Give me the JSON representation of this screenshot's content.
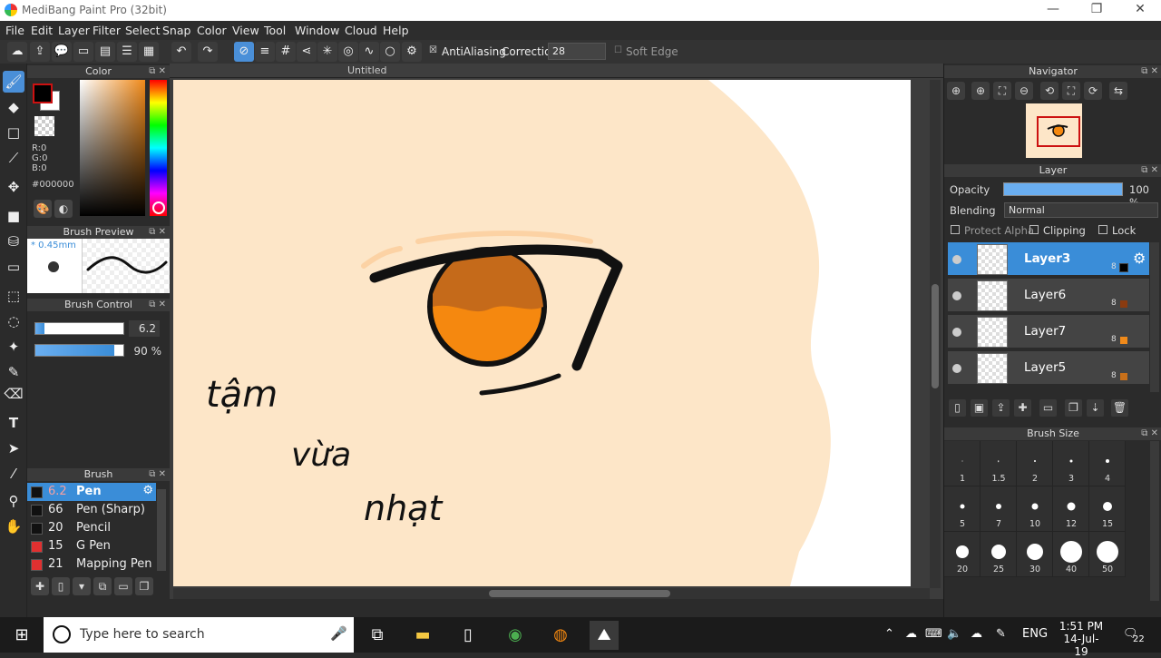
{
  "window": {
    "title": "MediBang Paint Pro (32bit)",
    "minimize": "—",
    "restore": "❐",
    "close": "✕"
  },
  "menu": [
    "File",
    "Edit",
    "Layer",
    "Filter",
    "Select",
    "Snap",
    "Color",
    "View",
    "Tool",
    "Window",
    "Cloud",
    "Help"
  ],
  "toolbar": {
    "antialias_label": "AntiAliasing",
    "correction_label": "Correction",
    "correction_value": "28",
    "soft_edge_label": "Soft Edge"
  },
  "color_panel": {
    "title": "Color",
    "r": "R:0",
    "g": "G:0",
    "b": "B:0",
    "hex": "#000000",
    "fg": "#000000",
    "bg": "#ffffff"
  },
  "brush_preview": {
    "title": "Brush Preview",
    "size": "* 0.45mm"
  },
  "brush_control": {
    "title": "Brush Control",
    "size_value": "6.2",
    "size_fraction": 0.1,
    "opacity_value": "90 %",
    "opacity_fraction": 0.9
  },
  "brush_panel": {
    "title": "Brush",
    "items": [
      {
        "num": "6.2",
        "name": "Pen",
        "color": "#111111",
        "selected": true
      },
      {
        "num": "66",
        "name": "Pen (Sharp)",
        "color": "#111111"
      },
      {
        "num": "20",
        "name": "Pencil",
        "color": "#111111"
      },
      {
        "num": "15",
        "name": "G Pen",
        "color": "#e03030"
      },
      {
        "num": "21",
        "name": "Mapping Pen",
        "color": "#e03030"
      }
    ]
  },
  "document": {
    "tab": "Untitled",
    "handwriting": [
      "tậm",
      "vừa",
      "nhạt"
    ]
  },
  "navigator": {
    "title": "Navigator"
  },
  "layer_panel": {
    "title": "Layer",
    "opacity_label": "Opacity",
    "opacity_value": "100 %",
    "blending_label": "Blending",
    "blending_value": "Normal",
    "protect_alpha": "Protect Alpha",
    "clipping": "Clipping",
    "lock": "Lock",
    "layers": [
      {
        "name": "Layer3",
        "bits": "8",
        "color": "#000000",
        "selected": true
      },
      {
        "name": "Layer6",
        "bits": "8",
        "color": "#8a3b10"
      },
      {
        "name": "Layer7",
        "bits": "8",
        "color": "#f08a1a"
      },
      {
        "name": "Layer5",
        "bits": "8",
        "color": "#c8701a"
      }
    ]
  },
  "brush_size": {
    "title": "Brush Size",
    "sizes": [
      "1",
      "1.5",
      "2",
      "3",
      "4",
      "5",
      "7",
      "10",
      "12",
      "15",
      "20",
      "25",
      "30",
      "40",
      "50"
    ]
  },
  "taskbar": {
    "search_placeholder": "Type here to search",
    "lang": "ENG",
    "time": "1:51 PM",
    "date": "14-Jul-19",
    "notifications": "22"
  }
}
